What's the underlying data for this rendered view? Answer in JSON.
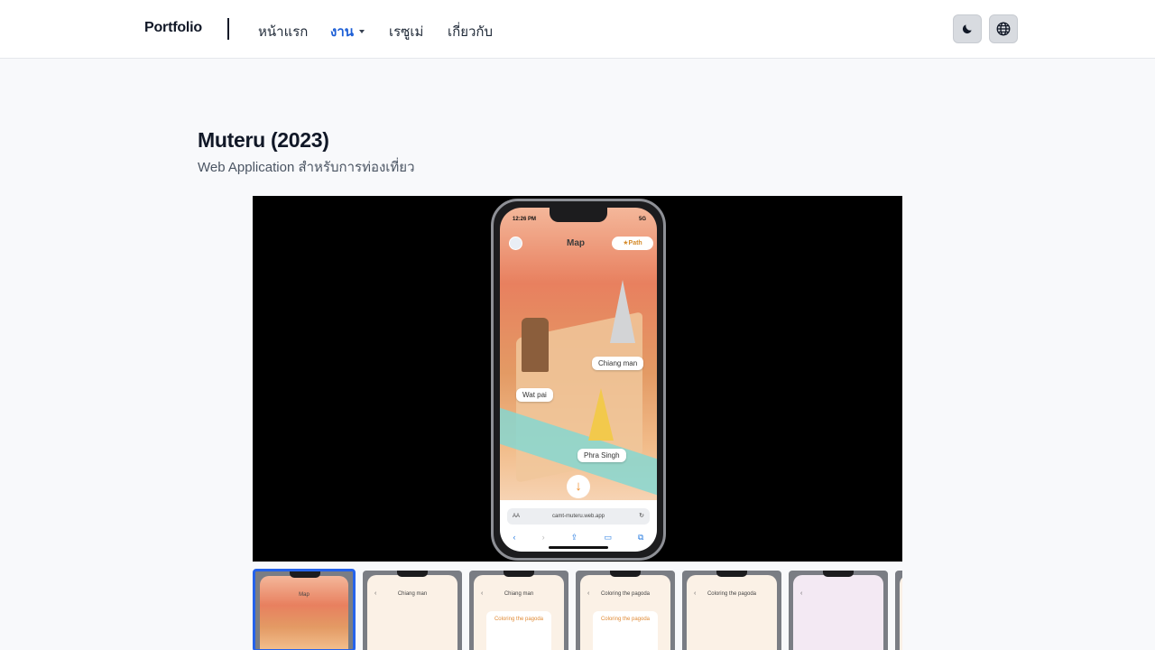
{
  "nav": {
    "brand": "Portfolio",
    "links": [
      {
        "label": "หน้าแรก"
      },
      {
        "label": "งาน"
      },
      {
        "label": "เรซูเม่"
      },
      {
        "label": "เกี่ยวกับ"
      }
    ]
  },
  "project": {
    "title": "Muteru (2023)",
    "subtitle": "Web Application สำหรับการท่องเที่ยว"
  },
  "video": {
    "status_time": "12:26 PM",
    "status_signal": "5G",
    "map_title": "Map",
    "path_button": "★Path",
    "labels": {
      "chiang_man": "Chiang man",
      "wat": "Wat pai",
      "phra_singh": "Phra Singh"
    },
    "url": "camt-muteru.web.app",
    "url_aa": "AA"
  },
  "thumbnails": [
    {
      "title": "Map",
      "card": ""
    },
    {
      "title": "Chiang man",
      "card": ""
    },
    {
      "title": "Chiang man",
      "card": "Coloring the pagoda"
    },
    {
      "title": "Coloring the pagoda",
      "card": "Coloring the pagoda"
    },
    {
      "title": "Coloring the pagoda",
      "card": ""
    },
    {
      "title": "",
      "card": ""
    },
    {
      "title": "",
      "card": ""
    }
  ],
  "colors": {
    "accent": "#1d5fd6",
    "selected_border": "#2563eb"
  },
  "icons": {
    "theme": "moon-icon",
    "language": "globe-icon"
  }
}
